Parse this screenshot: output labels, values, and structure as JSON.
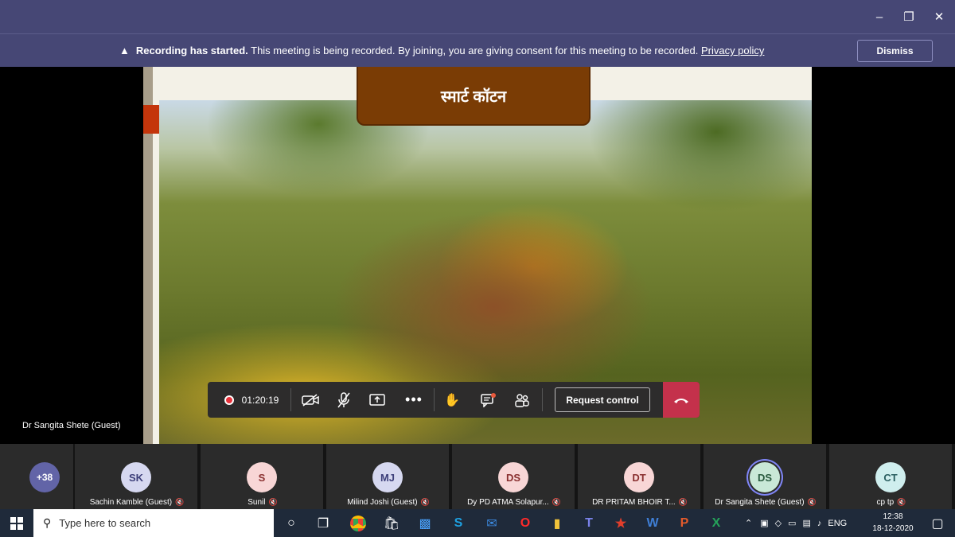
{
  "window": {
    "minimize_icon": "minimize-icon",
    "restore_icon": "restore-icon",
    "close_icon": "close-icon"
  },
  "banner": {
    "bold": "Recording has started.",
    "text": " This meeting is being recorded. By joining, you are giving consent for this meeting to be recorded. ",
    "link": "Privacy policy",
    "dismiss": "Dismiss"
  },
  "slide": {
    "title": "स्मार्ट कॉटन"
  },
  "speaker": "Dr Sangita Shete (Guest)",
  "toolbar": {
    "timer": "01:20:19",
    "request_control": "Request control"
  },
  "participants": {
    "more": "+38",
    "tiles": [
      {
        "initials": "SK",
        "name": "Sachin Kamble (Guest)",
        "bg": "#d6d8f0",
        "fg": "#3d3f7a"
      },
      {
        "initials": "S",
        "name": "Sunil",
        "bg": "#f8d6d6",
        "fg": "#8a3030"
      },
      {
        "initials": "MJ",
        "name": "Milind Joshi (Guest)",
        "bg": "#d6d8f0",
        "fg": "#3d3f7a"
      },
      {
        "initials": "DS",
        "name": "Dy PD ATMA Solapur...",
        "bg": "#f8d6d6",
        "fg": "#8a3030"
      },
      {
        "initials": "DT",
        "name": "DR PRITAM BHOIR T...",
        "bg": "#f8d6d6",
        "fg": "#8a3030"
      },
      {
        "initials": "DS",
        "name": "Dr Sangita Shete (Guest)",
        "bg": "#c9e8d7",
        "fg": "#2a5a3f"
      },
      {
        "initials": "CT",
        "name": "cp tp",
        "bg": "#cfeeee",
        "fg": "#2a5e60"
      }
    ]
  },
  "taskbar": {
    "search_placeholder": "Type here to search",
    "language": "ENG",
    "time": "12:38",
    "date": "18-12-2020"
  }
}
